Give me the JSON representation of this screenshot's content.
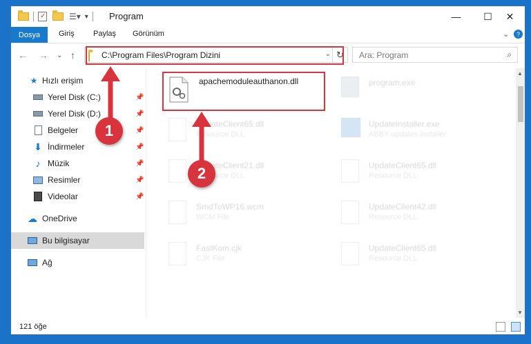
{
  "window": {
    "title": "Program",
    "minimize": "—",
    "maximize": "☐",
    "close": "✕"
  },
  "ribbon": {
    "file_tab": "Dosya",
    "tabs": [
      "Giriş",
      "Paylaş",
      "Görünüm"
    ],
    "help": "?",
    "expand": "⌄"
  },
  "nav": {
    "back": "←",
    "forward": "→",
    "recent": "⌄",
    "up": "↑",
    "address": "C:\\Program Files\\Program Dizini",
    "address_drop": "⌄",
    "refresh": "↻",
    "search_placeholder": "Ara: Program",
    "search_icon": "⌕"
  },
  "sidebar": {
    "items": [
      {
        "label": "Hızlı erişim",
        "icon": "star-icon",
        "pinned": false
      },
      {
        "label": "Yerel Disk (C:)",
        "icon": "drive-icon",
        "pinned": true
      },
      {
        "label": "Yerel Disk (D:)",
        "icon": "drive-icon",
        "pinned": true
      },
      {
        "label": "Belgeler",
        "icon": "documents-icon",
        "pinned": true
      },
      {
        "label": "İndirmeler",
        "icon": "downloads-icon",
        "pinned": true
      },
      {
        "label": "Müzik",
        "icon": "music-icon",
        "pinned": true
      },
      {
        "label": "Resimler",
        "icon": "pictures-icon",
        "pinned": true
      },
      {
        "label": "Videolar",
        "icon": "videos-icon",
        "pinned": true
      },
      {
        "label": "OneDrive",
        "icon": "cloud-icon",
        "pinned": false
      },
      {
        "label": "Bu bilgisayar",
        "icon": "computer-icon",
        "pinned": false,
        "selected": true
      },
      {
        "label": "Ağ",
        "icon": "network-icon",
        "pinned": false
      }
    ]
  },
  "files": [
    {
      "name": "apachemoduleauthanon.dll",
      "type": "",
      "highlighted": true
    },
    {
      "name": "program.exe",
      "type": ""
    },
    {
      "name": "UpdateClient65.dll",
      "type": "Resource DLL"
    },
    {
      "name": "UpdateInstaller.exe",
      "type": "ABBY updates installer"
    },
    {
      "name": "UpdateClient21.dll",
      "type": "Resource DLL"
    },
    {
      "name": "UpdateClient65.dll",
      "type": "Resource DLL"
    },
    {
      "name": "SmdToWP16.wcm",
      "type": "WCM File"
    },
    {
      "name": "UpdateClient42.dll",
      "type": "Resource DLL"
    },
    {
      "name": "FastKom.cjk",
      "type": "CJK File"
    },
    {
      "name": "UpdateClient65.dll",
      "type": "Resource DLL"
    }
  ],
  "status": {
    "count": "121 öğe"
  },
  "annotations": {
    "step1": "1",
    "step2": "2",
    "accent": "#d8343d"
  }
}
